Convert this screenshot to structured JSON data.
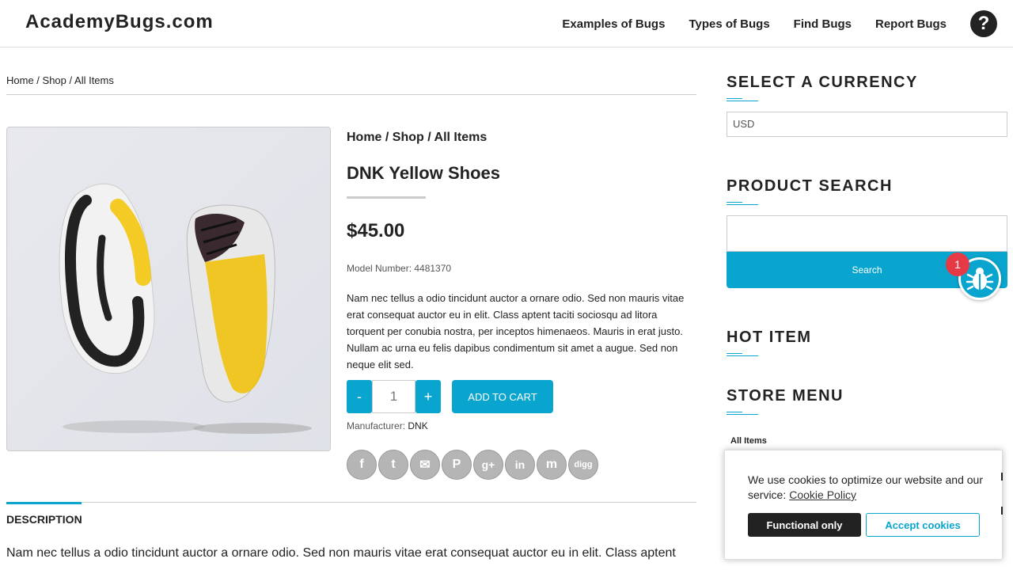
{
  "header": {
    "logo": "AcademyBugs.com",
    "nav": [
      "Examples of Bugs",
      "Types of Bugs",
      "Find Bugs",
      "Report Bugs"
    ],
    "help_icon": "question-circle-icon"
  },
  "breadcrumb": {
    "home": "Home",
    "sep1": " / ",
    "shop": "Shop",
    "sep2": " / All Items"
  },
  "product": {
    "breadcrumb": "Home / Shop / All Items",
    "title": "DNK Yellow Shoes",
    "price": "$45.00",
    "model": "Model Number: 4481370",
    "description": "Nam nec tellus a odio tincidunt auctor a ornare odio. Sed non mauris vitae erat consequat auctor eu in elit. Class aptent taciti sociosqu ad litora torquent per conubia nostra, per inceptos himenaeos. Mauris in erat justo. Nullam ac urna eu felis dapibus condimentum sit amet a augue. Sed non neque elit sed.",
    "qty_minus": "-",
    "qty_value": "1",
    "qty_plus": "+",
    "add_to_cart": "ADD TO CART",
    "manufacturer_label": "Manufacturer: ",
    "manufacturer": "DNK",
    "image_icon": "sneaker-image"
  },
  "social": [
    {
      "icon": "facebook-icon",
      "glyph": "f"
    },
    {
      "icon": "twitter-icon",
      "glyph": "t"
    },
    {
      "icon": "email-icon",
      "glyph": "✉"
    },
    {
      "icon": "pinterest-icon",
      "glyph": "P"
    },
    {
      "icon": "googleplus-icon",
      "glyph": "g+"
    },
    {
      "icon": "linkedin-icon",
      "glyph": "in"
    },
    {
      "icon": "myspace-icon",
      "glyph": "m"
    },
    {
      "icon": "digg-icon",
      "glyph": "digg"
    }
  ],
  "tabs": {
    "description": "DESCRIPTION",
    "description_text": "Nam nec tellus a odio tincidunt auctor a ornare odio. Sed non mauris vitae erat consequat auctor eu in elit. Class aptent"
  },
  "sidebar": {
    "currency_heading": "SELECT A CURRENCY",
    "currency_value": "USD",
    "search_heading": "PRODUCT SEARCH",
    "search_button": "Search",
    "hot_heading": "HOT ITEM",
    "store_heading": "STORE MENU",
    "store_item": "All Items"
  },
  "bug_widget": {
    "badge": "1",
    "icon": "bug-icon"
  },
  "cookie": {
    "text": "We use cookies to optimize our website and our service:",
    "policy_link": "Cookie Policy",
    "functional": "Functional only",
    "accept": "Accept cookies"
  },
  "colors": {
    "accent": "#0aa5ce",
    "badge": "#e63946",
    "dark": "#222222"
  }
}
